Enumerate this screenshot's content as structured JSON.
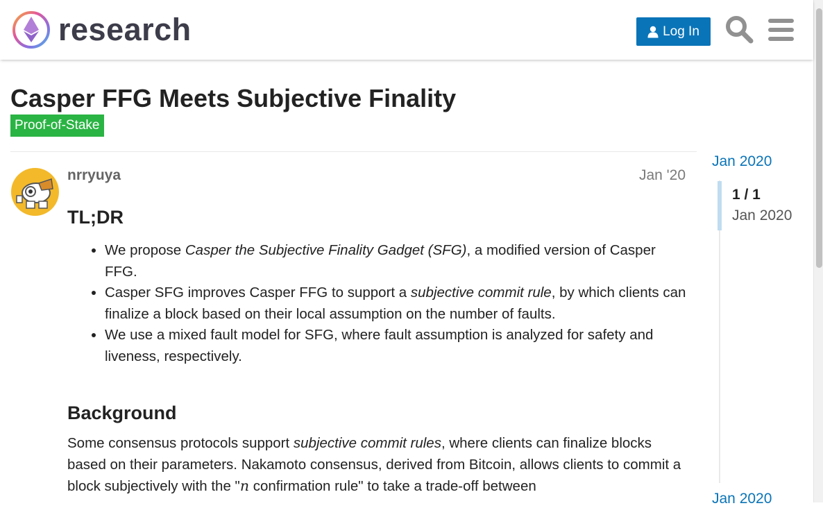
{
  "header": {
    "logo_text": "research",
    "login_label": "Log In",
    "search_icon": "search-icon",
    "menu_icon": "hamburger-icon",
    "colors": {
      "login_bg": "#0a74b8"
    }
  },
  "topic": {
    "title": "Casper FFG Meets Subjective Finality",
    "category": "Proof-of-Stake",
    "category_color": "#2ab443"
  },
  "post": {
    "author": "nrryuya",
    "date": "Jan '20",
    "tldr_heading": "TL;DR",
    "bullets": [
      {
        "pre": "We propose ",
        "em": "Casper the Subjective Finality Gadget (SFG)",
        "post": ", a modified version of Casper FFG."
      },
      {
        "pre": "Casper SFG improves Casper FFG to support a ",
        "em": "subjective commit rule",
        "post": ", by which clients can finalize a block based on their local assumption on the number of faults."
      },
      {
        "text": "We use a mixed fault model for SFG, where fault assumption is analyzed for safety and liveness, respectively."
      }
    ],
    "background_heading": "Background",
    "background_para": {
      "pre": "Some consensus protocols support ",
      "em": "subjective commit rules",
      "mid": ", where clients can finalize blocks based on their parameters. Nakamoto consensus, derived from Bitcoin, allows clients to commit a block subjectively with the \"",
      "math": "n",
      "post": " confirmation rule\" to take a trade-off between"
    }
  },
  "timeline": {
    "top_date": "Jan 2020",
    "count": "1 / 1",
    "current_date": "Jan 2020",
    "bottom_date": "Jan 2020"
  }
}
